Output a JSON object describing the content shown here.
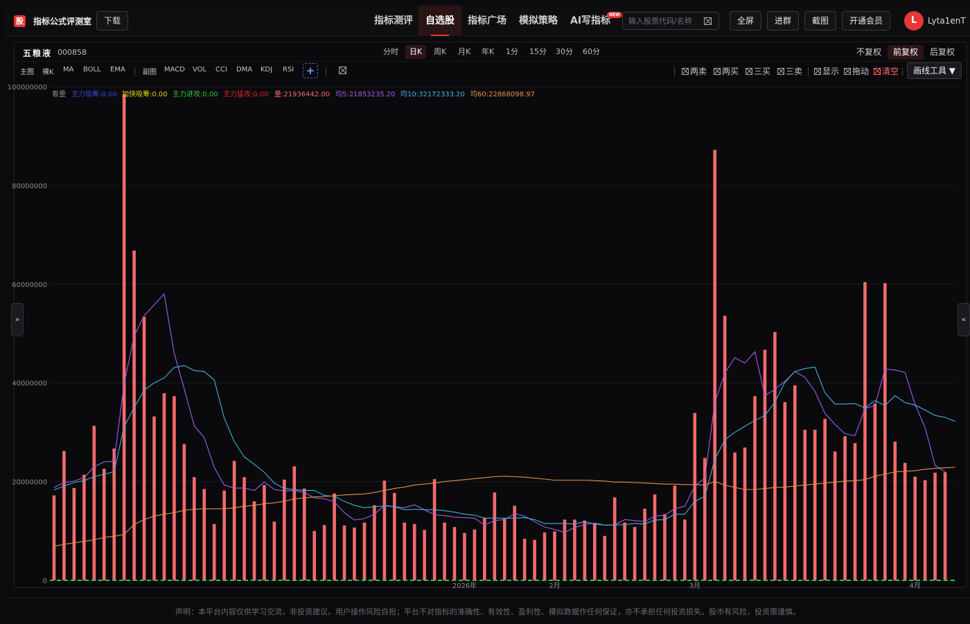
{
  "header": {
    "logo_char": "股",
    "app_title": "指标公式评测室",
    "download": "下载",
    "nav": [
      "指标测评",
      "自选股",
      "指标广场",
      "模拟策略",
      "AI写指标"
    ],
    "new_badge": "NEW",
    "search_placeholder": "输入股票代码/名称",
    "buttons": [
      "全屏",
      "进群",
      "截图",
      "开通会员"
    ],
    "avatar_letter": "L",
    "username": "Lyta1enT"
  },
  "stock": {
    "name": "五粮液",
    "code": "000858"
  },
  "periods": [
    "分时",
    "日K",
    "周K",
    "月K",
    "年K",
    "1分",
    "15分",
    "30分",
    "60分"
  ],
  "active_period": "日K",
  "adjust": [
    "不复权",
    "前复权",
    "后复权"
  ],
  "active_adjust": "前复权",
  "toolbar_left": [
    "主图",
    "裸K",
    "MA",
    "BOLL",
    "EMA",
    "副图",
    "MACD",
    "VOL",
    "CCI",
    "DMA",
    "KDJ",
    "RSI"
  ],
  "plus_label": "+",
  "toolbar_right": [
    "两卖",
    "两买",
    "三买",
    "三卖",
    "显示",
    "拖动",
    "清空"
  ],
  "draw_tools_label": "画线工具 ▼",
  "side_left": "»",
  "side_right": "«",
  "footer_text": "声明：本平台内容仅供学习交流，非投资建议。用户操作风险自担；平台不对指标的准确性、有效性、盈利性、模拟数据作任何保证，亦不承担任何投资损失。股市有风险，投资需谨慎。",
  "colors": {
    "bar": "#f26a6a",
    "ma5": "#a45cf0",
    "ma10": "#3fb3e0",
    "ma60": "#e8924a",
    "accent": "#e53935"
  },
  "chart_data": {
    "type": "bar",
    "indicator": "看量",
    "legend": [
      {
        "text": "主力吸筹:0.00",
        "color": "#2f4ad8"
      },
      {
        "text": "加快吸筹:0.00",
        "color": "#e8d400"
      },
      {
        "text": "主力进攻:0.00",
        "color": "#2fc43a"
      },
      {
        "text": "主力猛攻:0.00",
        "color": "#e02424"
      },
      {
        "text": "量:21936442.00",
        "color": "#f26a6a"
      },
      {
        "text": "均5:21853235.20",
        "color": "#a45cf0"
      },
      {
        "text": "均10:32172333.20",
        "color": "#3fb3e0"
      },
      {
        "text": "均60:22868098.97",
        "color": "#e8924a"
      }
    ],
    "ylim": [
      0,
      100000000
    ],
    "y_ticks": [
      0,
      20000000,
      40000000,
      60000000,
      80000000,
      100000000
    ],
    "y_tick_labels": [
      "0",
      "20000000",
      "40000000",
      "60000000",
      "80000000",
      "100000000"
    ],
    "x_labels": [
      {
        "index": 41,
        "text": "2026年"
      },
      {
        "index": 50,
        "text": "2月"
      },
      {
        "index": 64,
        "text": "3月"
      },
      {
        "index": 86,
        "text": "4月"
      }
    ],
    "volume": [
      17200000,
      26200000,
      18700000,
      21400000,
      31300000,
      22600000,
      26700000,
      98500000,
      66800000,
      53400000,
      33200000,
      37900000,
      37300000,
      27600000,
      20900000,
      18500000,
      11400000,
      18200000,
      24200000,
      20900000,
      16000000,
      19300000,
      11900000,
      20400000,
      23100000,
      18600000,
      10000000,
      11200000,
      17600000,
      11100000,
      10700000,
      11700000,
      15200000,
      20200000,
      17700000,
      11700000,
      11400000,
      10200000,
      20500000,
      11700000,
      10800000,
      9600000,
      10300000,
      12700000,
      17800000,
      12500000,
      15100000,
      8400000,
      8200000,
      9700000,
      9900000,
      12300000,
      12300000,
      12100000,
      11500000,
      9000000,
      16800000,
      11700000,
      10800000,
      14500000,
      17400000,
      13400000,
      19200000,
      12300000,
      33900000,
      24800000,
      87200000,
      53600000,
      25900000,
      26900000,
      37300000,
      46700000,
      50300000,
      36100000,
      39500000,
      30500000,
      30500000,
      32700000,
      26100000,
      29200000,
      27800000,
      60400000,
      35800000,
      60200000,
      28100000,
      23800000,
      21000000,
      20300000,
      21800000,
      21900000
    ],
    "series": [
      {
        "name": "均5",
        "values": [
          18800000,
          19800000,
          20100000,
          20800000,
          23000000,
          24000000,
          24100000,
          39800000,
          49500000,
          53600000,
          55800000,
          58000000,
          46000000,
          38800000,
          31300000,
          28900000,
          22900000,
          19300000,
          18700000,
          18700000,
          18200000,
          19900000,
          18400000,
          18100000,
          18200000,
          17800000,
          16700000,
          16500000,
          15900000,
          13700000,
          12200000,
          12500000,
          13400000,
          15200000,
          14900000,
          14700000,
          15300000,
          14300000,
          13300000,
          13100000,
          12800000,
          12700000,
          12600000,
          11200000,
          12100000,
          12300000,
          13500000,
          13000000,
          11900000,
          10800000,
          10300000,
          9700000,
          10700000,
          11300000,
          11600000,
          11200000,
          11200000,
          12300000,
          12100000,
          11900000,
          13000000,
          13200000,
          14500000,
          15000000,
          19100000,
          20700000,
          36000000,
          42000000,
          45100000,
          44000000,
          46300000,
          37400000,
          38700000,
          40300000,
          42300000,
          41100000,
          38300000,
          33800000,
          31600000,
          29700000,
          29300000,
          34800000,
          35400000,
          42800000,
          42600000,
          42100000,
          35600000,
          31000000,
          23300000,
          22000000
        ]
      },
      {
        "name": "均10",
        "values": [
          18300000,
          19100000,
          19800000,
          20200000,
          21000000,
          21500000,
          22000000,
          31100000,
          35000000,
          38500000,
          40000000,
          41000000,
          43100000,
          43500000,
          42500000,
          42300000,
          40600000,
          32900000,
          28100000,
          25000000,
          23500000,
          21900000,
          19700000,
          18600000,
          18400000,
          18200000,
          18200000,
          17200000,
          17000000,
          16000000,
          15200000,
          14700000,
          14900000,
          15100000,
          14900000,
          14300000,
          14400000,
          14300000,
          14300000,
          14100000,
          13800000,
          13400000,
          13200000,
          12600000,
          12600000,
          12600000,
          12600000,
          12700000,
          12300000,
          11500000,
          11500000,
          11500000,
          11400000,
          11900000,
          11400000,
          11200000,
          11200000,
          11300000,
          11500000,
          11400000,
          12200000,
          12300000,
          13400000,
          13400000,
          16000000,
          17000000,
          24500000,
          28500000,
          30000000,
          31200000,
          32400000,
          33400000,
          36100000,
          40100000,
          42300000,
          42900000,
          43200000,
          38000000,
          35700000,
          35700000,
          35800000,
          34900000,
          36400000,
          35400000,
          37400000,
          36000000,
          35500000,
          34500000,
          33400000,
          33000000,
          32200000
        ]
      },
      {
        "name": "均60",
        "values": [
          6900000,
          7300000,
          7600000,
          7900000,
          8200000,
          8700000,
          8900000,
          9300000,
          11300000,
          12300000,
          13000000,
          13400000,
          13700000,
          14200000,
          14400000,
          14500000,
          14500000,
          14500000,
          14700000,
          15000000,
          15200000,
          15500000,
          15700000,
          16000000,
          16500000,
          16700000,
          16900000,
          17000000,
          17100000,
          17300000,
          17400000,
          17500000,
          17800000,
          18200000,
          18600000,
          18900000,
          19300000,
          19500000,
          19700000,
          20000000,
          20200000,
          20400000,
          20600000,
          20800000,
          21000000,
          21100000,
          21000000,
          20900000,
          20700000,
          20500000,
          20300000,
          20300000,
          20300000,
          20300000,
          20200000,
          20100000,
          19900000,
          19900000,
          19800000,
          19700000,
          19600000,
          19500000,
          19500000,
          19400000,
          19400000,
          19300000,
          20000000,
          19300000,
          18800000,
          18400000,
          18400000,
          18600000,
          18800000,
          18900000,
          19100000,
          19300000,
          19500000,
          19700000,
          19900000,
          20100000,
          20200000,
          20400000,
          21100000,
          21500000,
          22000000,
          22100000,
          22200000,
          22500000,
          22700000,
          22800000,
          22900000
        ]
      }
    ]
  }
}
